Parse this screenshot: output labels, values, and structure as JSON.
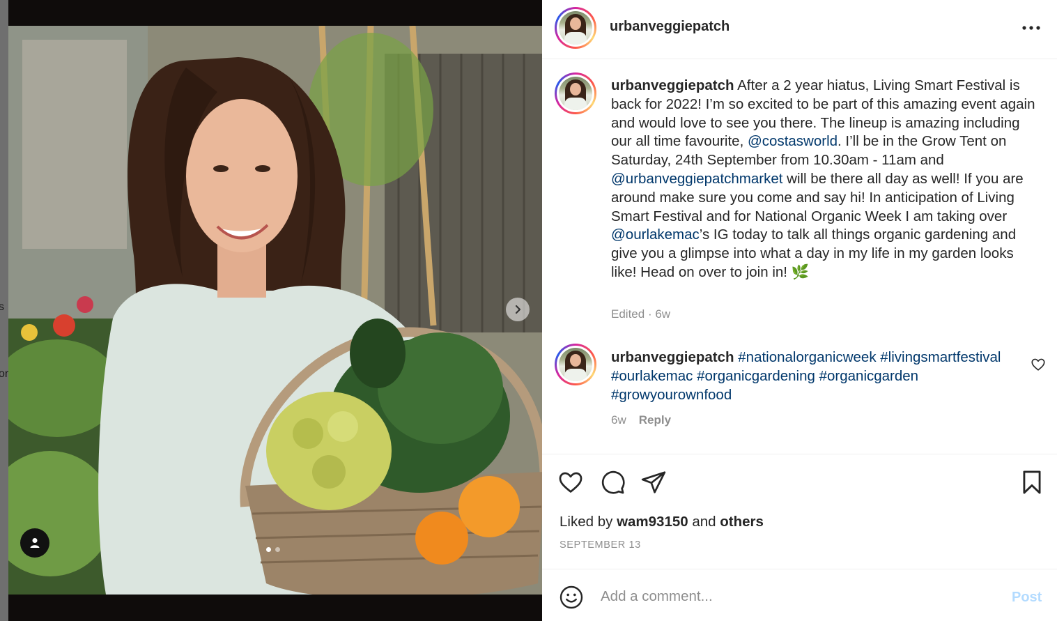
{
  "left_edge": {
    "fragments": [
      "s",
      "or"
    ]
  },
  "media": {
    "image_alt": "",
    "carousel": {
      "current": 1,
      "total": 2
    },
    "icons": {
      "next": "chevron-right-icon",
      "user_tag": "person-icon"
    }
  },
  "header": {
    "username": "urbanveggiepatch",
    "more_icon": "more-horizontal-icon"
  },
  "caption": {
    "username": "urbanveggiepatch",
    "text_1": " After a 2 year hiatus, Living Smart Festival is back for 2022! I’m so excited to be part of this amazing event again and would love to see you there. The lineup is amazing including our all time favourite, ",
    "mention_1": "@costasworld",
    "text_2": ". I’ll be in the Grow Tent on Saturday, 24th September from 10.30am - 11am and ",
    "mention_2": "@urbanveggiepatchmarket",
    "text_3": " will be there all day as well! If you are around make sure you come and say hi! In anticipation of Living Smart Festival and for National Organic Week I am taking over ",
    "mention_3": "@ourlakemac",
    "text_4": "’s IG today to talk all things organic gardening and give you a glimpse into what a day in my life in my garden looks like! Head on over to join in! ",
    "emoji": "🌿",
    "edited_label": "Edited",
    "separator": "·",
    "time": "6w"
  },
  "comment": {
    "username": "urbanveggiepatch",
    "hashtags": [
      "#nationalorganicweek",
      "#livingsmartfestival",
      "#ourlakemac",
      "#organicgardening",
      "#organicgarden",
      "#growyourownfood"
    ],
    "time": "6w",
    "reply_label": "Reply",
    "like_icon": "heart-outline-icon"
  },
  "actions": {
    "icons": [
      "heart-icon",
      "comment-icon",
      "share-icon",
      "bookmark-icon"
    ],
    "likes_prefix": "Liked by ",
    "liked_by_user": "wam93150",
    "likes_and": " and ",
    "likes_others": "others",
    "date": "SEPTEMBER 13"
  },
  "add_comment": {
    "placeholder": "Add a comment...",
    "post_label": "Post",
    "emoji_icon": "smiley-icon"
  },
  "colors": {
    "link": "#00376b",
    "muted": "#8e8e8e",
    "post_disabled": "#b3dbff",
    "text": "#262626"
  }
}
